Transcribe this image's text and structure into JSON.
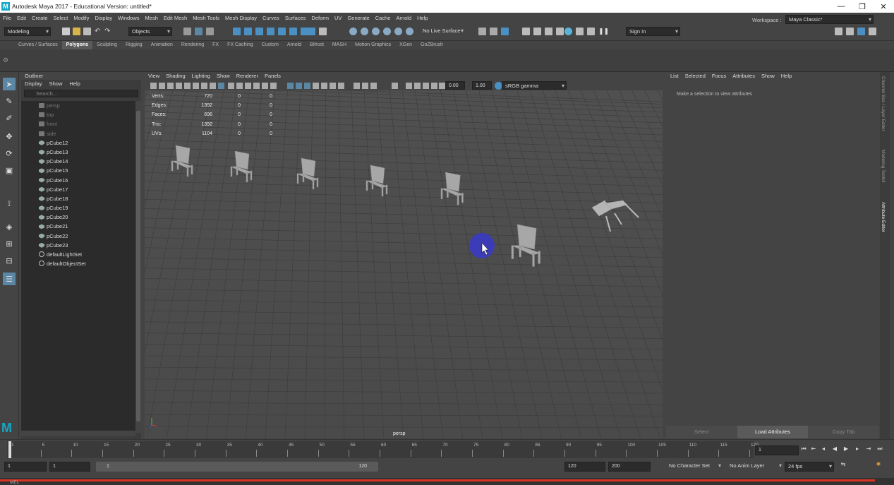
{
  "window": {
    "title": "Autodesk Maya 2017 - Educational Version: untitled*",
    "minimize": "—",
    "maximize": "❐",
    "close": "✕"
  },
  "menubar": [
    "File",
    "Edit",
    "Create",
    "Select",
    "Modify",
    "Display",
    "Windows",
    "Mesh",
    "Edit Mesh",
    "Mesh Tools",
    "Mesh Display",
    "Curves",
    "Surfaces",
    "Deform",
    "UV",
    "Generate",
    "Cache",
    "Arnold",
    "Help"
  ],
  "workspace": {
    "label": "Workspace :",
    "value": "Maya Classic*"
  },
  "statusline": {
    "mode": "Modeling",
    "selection_mode": "Objects",
    "live_surface": "No Live Surface",
    "sign_in": "Sign In"
  },
  "shelf_tabs": [
    "Curves / Surfaces",
    "Polygons",
    "Sculpting",
    "Rigging",
    "Animation",
    "Rendering",
    "FX",
    "FX Caching",
    "Custom",
    "Arnold",
    "Bifrost",
    "MASH",
    "Motion Graphics",
    "XGen",
    "GoZBrush"
  ],
  "shelf_active": "Polygons",
  "outliner": {
    "title": "Outliner",
    "menu": [
      "Display",
      "Show",
      "Help"
    ],
    "search_placeholder": "Search...",
    "items": [
      {
        "label": "persp",
        "type": "camera"
      },
      {
        "label": "top",
        "type": "camera"
      },
      {
        "label": "front",
        "type": "camera"
      },
      {
        "label": "side",
        "type": "camera"
      },
      {
        "label": "pCube12",
        "type": "mesh"
      },
      {
        "label": "pCube13",
        "type": "mesh"
      },
      {
        "label": "pCube14",
        "type": "mesh"
      },
      {
        "label": "pCube15",
        "type": "mesh"
      },
      {
        "label": "pCube16",
        "type": "mesh"
      },
      {
        "label": "pCube17",
        "type": "mesh"
      },
      {
        "label": "pCube18",
        "type": "mesh"
      },
      {
        "label": "pCube19",
        "type": "mesh"
      },
      {
        "label": "pCube20",
        "type": "mesh"
      },
      {
        "label": "pCube21",
        "type": "mesh"
      },
      {
        "label": "pCube22",
        "type": "mesh"
      },
      {
        "label": "pCube23",
        "type": "mesh"
      },
      {
        "label": "defaultLightSet",
        "type": "set"
      },
      {
        "label": "defaultObjectSet",
        "type": "set"
      }
    ]
  },
  "viewport": {
    "menu": [
      "View",
      "Shading",
      "Lighting",
      "Show",
      "Renderer",
      "Panels"
    ],
    "exposure": "0.00",
    "gamma": "1.00",
    "color_space": "sRGB gamma",
    "camera": "persp",
    "hud": [
      {
        "label": "Verts:",
        "a": "720",
        "b": "0",
        "c": "0"
      },
      {
        "label": "Edges:",
        "a": "1392",
        "b": "0",
        "c": "0"
      },
      {
        "label": "Faces:",
        "a": "696",
        "b": "0",
        "c": "0"
      },
      {
        "label": "Tris:",
        "a": "1392",
        "b": "0",
        "c": "0"
      },
      {
        "label": "UVs:",
        "a": "1104",
        "b": "0",
        "c": "0"
      }
    ]
  },
  "attribute_editor": {
    "menu": [
      "List",
      "Selected",
      "Focus",
      "Attributes",
      "Show",
      "Help"
    ],
    "message": "Make a selection to view attributes",
    "buttons": [
      "Select",
      "Load Attributes",
      "Copy Tab"
    ]
  },
  "side_tabs": [
    "Channel Box / Layer Editor",
    "Modeling Toolkit",
    "Attribute Editor"
  ],
  "timeline": {
    "ticks": [
      "1",
      "5",
      "10",
      "15",
      "20",
      "25",
      "30",
      "35",
      "40",
      "45",
      "50",
      "55",
      "60",
      "65",
      "70",
      "75",
      "80",
      "85",
      "90",
      "95",
      "100",
      "105",
      "110",
      "115",
      "120"
    ],
    "current_frame": "1"
  },
  "range": {
    "start": "1",
    "playback_start": "1",
    "slider_start": "1",
    "slider_end": "120",
    "playback_end": "120",
    "end": "200",
    "character_set": "No Character Set",
    "anim_layer": "No Anim Layer",
    "fps": "24 fps"
  },
  "cmdline": {
    "label": "MEL"
  }
}
